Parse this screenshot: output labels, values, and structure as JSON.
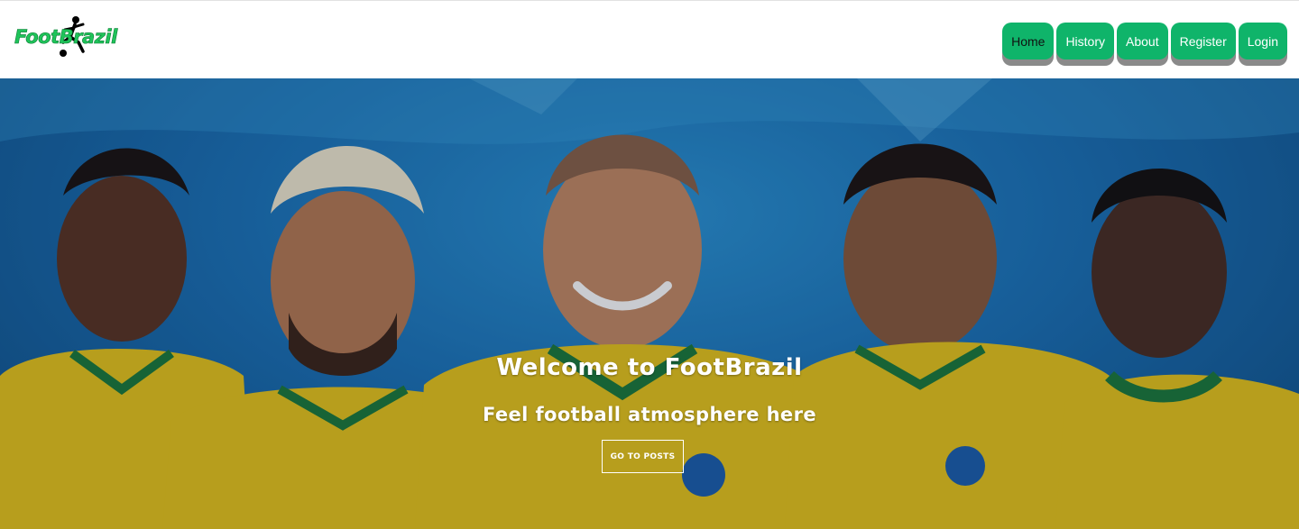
{
  "brand": {
    "name": "FootBrazil",
    "logo_icon": "soccer-player-kick-icon",
    "color_primary": "#0fb46a",
    "color_logo": "#1fc45a"
  },
  "nav": {
    "items": [
      {
        "label": "Home",
        "active": true
      },
      {
        "label": "History",
        "active": false
      },
      {
        "label": "About",
        "active": false
      },
      {
        "label": "Register",
        "active": false
      },
      {
        "label": "Login",
        "active": false
      }
    ]
  },
  "hero": {
    "title": "Welcome to FootBrazil",
    "subtitle": "Feel football atmosphere here",
    "cta_label": "GO TO POSTS",
    "background": "photo collage of five Brazil national football team players in yellow jerseys on blue background",
    "color_background": "#1b73b8",
    "color_jersey": "#e8c61a"
  }
}
